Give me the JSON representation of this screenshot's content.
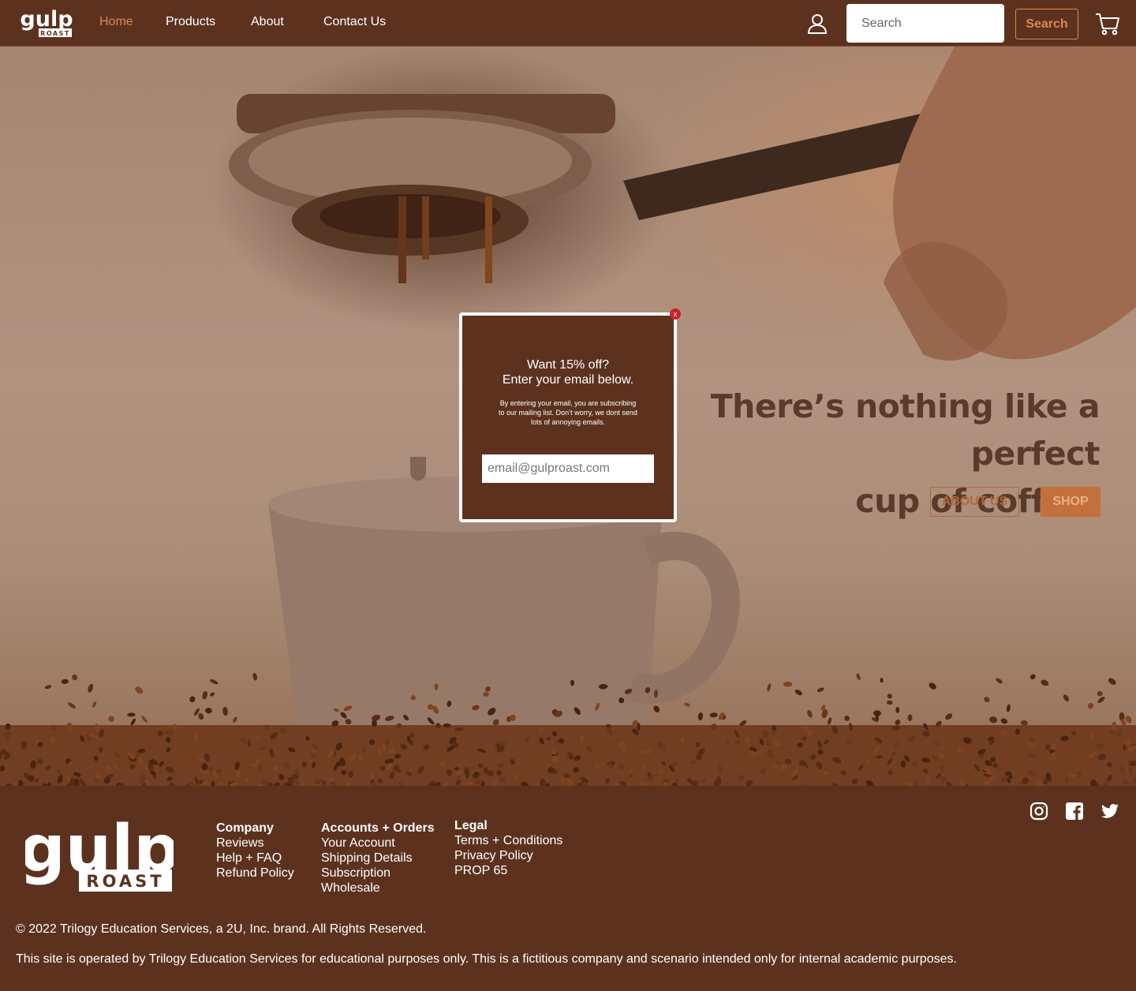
{
  "brand": {
    "logo_word": "gulp",
    "logo_sub": "ROAST"
  },
  "nav": {
    "links": [
      "Home",
      "Products",
      "About",
      "Contact Us"
    ],
    "active_link": "Home",
    "search_placeholder": "Search",
    "search_button": "Search"
  },
  "hero": {
    "heading_line1": "There’s nothing like a perfect",
    "heading_line2": "cup of coffee.",
    "about_button": "ABOUT US",
    "shop_button": "SHOP"
  },
  "modal": {
    "close_label": "x",
    "title_line1": "Want 15% off?",
    "title_line2": "Enter your email below.",
    "note": "By entering your email, you are subscribing to our mailing list. Don’t worry, we dont send lots of annoying emails.",
    "email_placeholder": "email@gulproast.com"
  },
  "footer": {
    "columns": [
      {
        "heading": "Company",
        "links": [
          "Reviews",
          "Help + FAQ",
          "Refund Policy"
        ]
      },
      {
        "heading": "Accounts + Orders",
        "links": [
          "Your Account",
          "Shipping Details",
          "Subscription",
          "Wholesale"
        ]
      },
      {
        "heading": "Legal",
        "links": [
          "Terms + Conditions",
          "Privacy Policy",
          "PROP 65"
        ]
      }
    ],
    "social": [
      "instagram-icon",
      "facebook-icon",
      "twitter-icon"
    ],
    "copyright": "© 2022 Trilogy Education Services, a 2U, Inc. brand. All Rights Reserved.",
    "disclaimer": "This site is operated by Trilogy Education Services for educational purposes only. This is a fictitious company and scenario intended only for internal academic purposes."
  },
  "colors": {
    "brand_brown": "#5c321f",
    "accent_orange": "#d9874f",
    "close_red": "#c8232c"
  }
}
